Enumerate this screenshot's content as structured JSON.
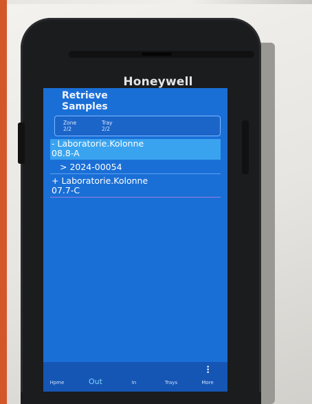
{
  "device": {
    "brand": "Honeywell"
  },
  "screen": {
    "title_line1": "Retrieve",
    "title_line2": "Samples",
    "zone": {
      "label": "Zone",
      "value": "2/2"
    },
    "tray": {
      "label": "Tray",
      "value": "2/2"
    },
    "list": [
      {
        "line1": "- Laboratorie.Kolonne",
        "line2": "08.8-A",
        "selected": true
      },
      {
        "line1": "> 2024-00054",
        "selected": false
      },
      {
        "line1": "+ Laboratorie.Kolonne",
        "line2": "07.7-C",
        "selected": false
      }
    ]
  },
  "nav": {
    "items": [
      {
        "label": "Hpme"
      },
      {
        "label": "Out",
        "active": true
      },
      {
        "label": "In"
      },
      {
        "label": "Trays"
      },
      {
        "label": "More"
      }
    ]
  },
  "colors": {
    "screen_bg": "#1a6fd6",
    "selection": "#3aa3ef",
    "nav_bg": "#1556b4"
  }
}
